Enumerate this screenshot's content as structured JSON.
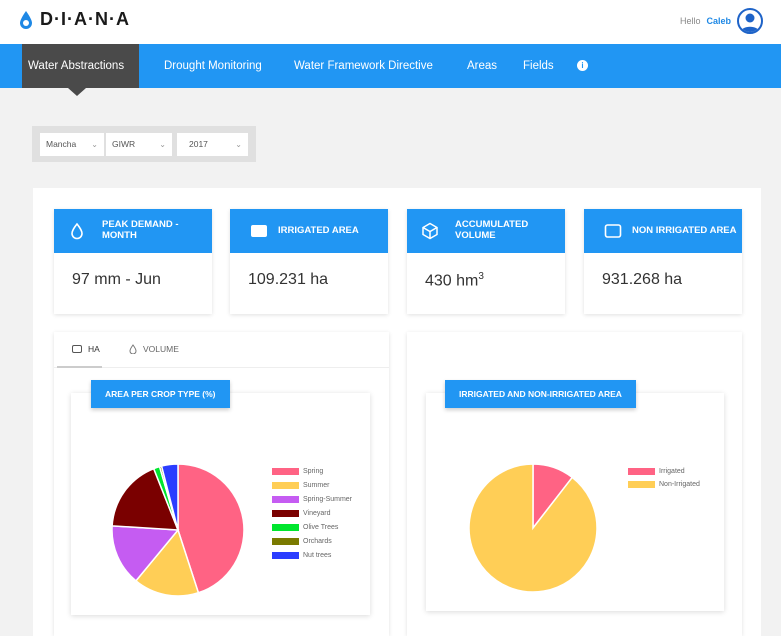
{
  "app": {
    "logo_text": "D·I·A·N·A"
  },
  "user": {
    "greeting": "Hello",
    "name": "Caleb"
  },
  "nav": {
    "items": [
      {
        "label": "Water Abstractions",
        "active": true
      },
      {
        "label": "Drought Monitoring"
      },
      {
        "label": "Water Framework Directive"
      },
      {
        "label": "Areas"
      },
      {
        "label": "Fields"
      }
    ],
    "info_glyph": "i"
  },
  "filters": {
    "region": "Mancha",
    "type": "GIWR",
    "year": "2017"
  },
  "cards": [
    {
      "title": "PEAK DEMAND - MONTH",
      "value": "97 mm - Jun",
      "icon": "drop-icon"
    },
    {
      "title": "IRRIGATED AREA",
      "value": "109.231 ha",
      "icon": "rectangle-icon"
    },
    {
      "title": "ACCUMULATED VOLUME",
      "value": "430 hm",
      "value_sup": "3",
      "icon": "cube-icon"
    },
    {
      "title": "NON IRRIGATED AREA",
      "value": "931.268 ha",
      "icon": "square-outline-icon"
    }
  ],
  "tabs": [
    {
      "label": "HA"
    },
    {
      "label": "VOLUME"
    }
  ],
  "colors": {
    "accent": "#2196f3",
    "nav_active": "#4a4a4a",
    "spring": "#ff6384",
    "summer": "#ffce56",
    "spring_summer": "#c55cf2",
    "vineyard": "#7a0000",
    "olive": "#00e62e",
    "orchards": "#7a7a00",
    "nut": "#2b3dff"
  },
  "chart_data": [
    {
      "type": "pie",
      "title": "AREA PER CROP TYPE (%)",
      "categories": [
        "Spring",
        "Summer",
        "Spring-Summer",
        "Vineyard",
        "Olive Trees",
        "Orchards",
        "Nut trees"
      ],
      "values": [
        45,
        16,
        15,
        18,
        1.5,
        0.5,
        4
      ],
      "colors": [
        "#ff6384",
        "#ffce56",
        "#c55cf2",
        "#7a0000",
        "#00e62e",
        "#7a7a00",
        "#2b3dff"
      ]
    },
    {
      "type": "pie",
      "title": "IRRIGATED AND NON-IRRIGATED AREA",
      "categories": [
        "Irrigated",
        "Non-Irrigated"
      ],
      "values": [
        10.5,
        89.5
      ],
      "colors": [
        "#ff6384",
        "#ffce56"
      ]
    }
  ]
}
